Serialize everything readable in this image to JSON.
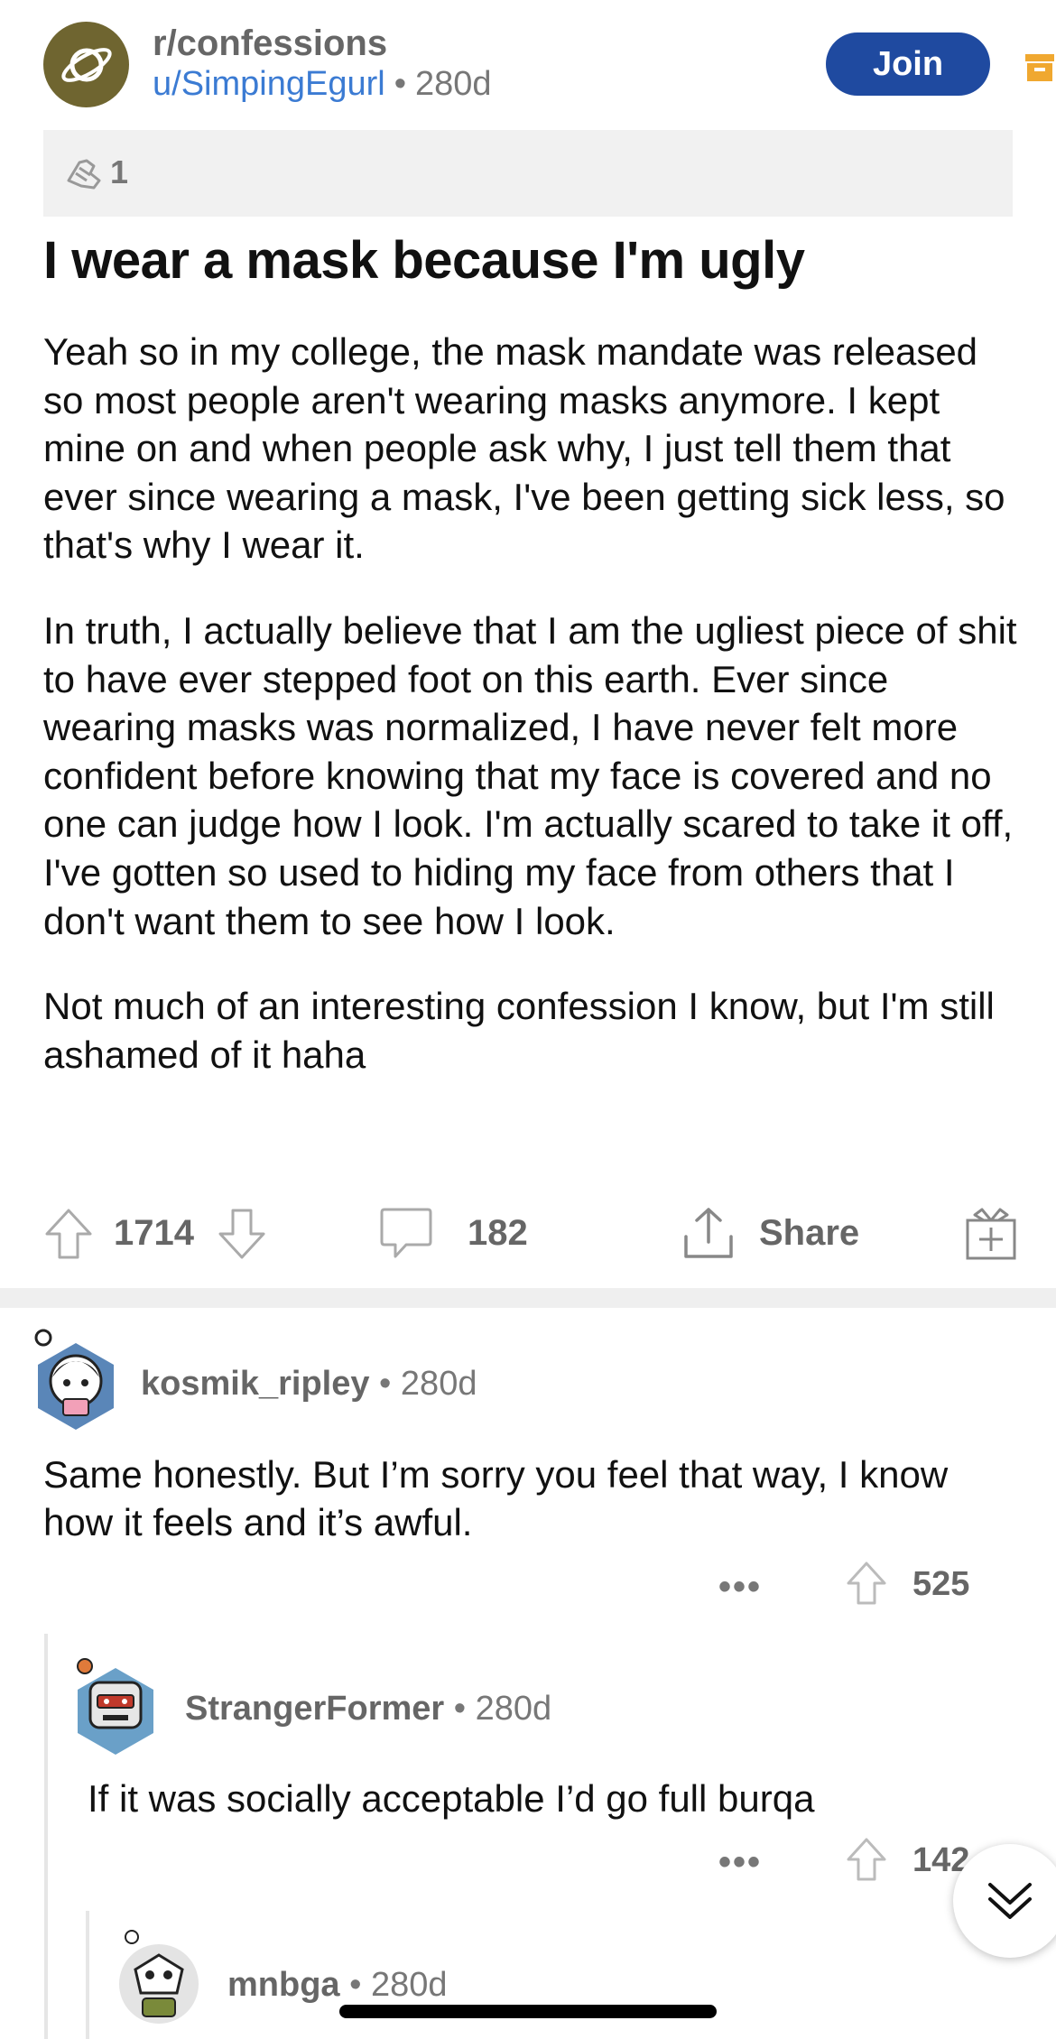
{
  "post": {
    "subreddit": "r/confessions",
    "author": "u/SimpingEgurl",
    "separator": "•",
    "age": "280d",
    "join_label": "Join",
    "award_count": "1",
    "title": "I wear a mask because I'm ugly",
    "paragraphs": [
      "Yeah so in my college, the mask mandate was released so most people aren't wearing masks anymore. I kept mine on and when people ask why, I just tell them that ever since wearing a mask, I've been getting sick less, so that's why I wear it.",
      "In truth, I actually believe that I am the ugliest piece of shit to have ever stepped foot on this earth. Ever since wearing masks was normalized, I have never felt more confident before knowing that my face is covered and no one can judge how I look. I'm actually scared to take it off, I've gotten so used to hiding my face from others that I don't want them to see how I look.",
      "Not much of an interesting confession I know, but I'm still ashamed of it haha"
    ],
    "score": "1714",
    "comment_count": "182",
    "share_label": "Share"
  },
  "comments": [
    {
      "author": "kosmik_ripley",
      "separator": "•",
      "age": "280d",
      "text": "Same honestly. But I’m sorry you feel that way, I know how it feels and it’s awful.",
      "more": "•••",
      "score": "525"
    },
    {
      "author": "StrangerFormer",
      "separator": "•",
      "age": "280d",
      "text": "If it was socially acceptable I’d go full burqa",
      "more": "•••",
      "score": "142"
    },
    {
      "author": "mnbga",
      "separator": "•",
      "age": "280d"
    }
  ],
  "colors": {
    "join_button": "#1f4aa0",
    "author_link": "#3b7bd3",
    "subreddit_avatar": "#6f6530",
    "archive_icon": "#f0a830"
  },
  "icons": [
    "planet-icon",
    "archive-icon",
    "award-icon",
    "upvote-icon",
    "downvote-icon",
    "comment-icon",
    "share-icon",
    "gift-icon",
    "chevron-double-down-icon"
  ]
}
